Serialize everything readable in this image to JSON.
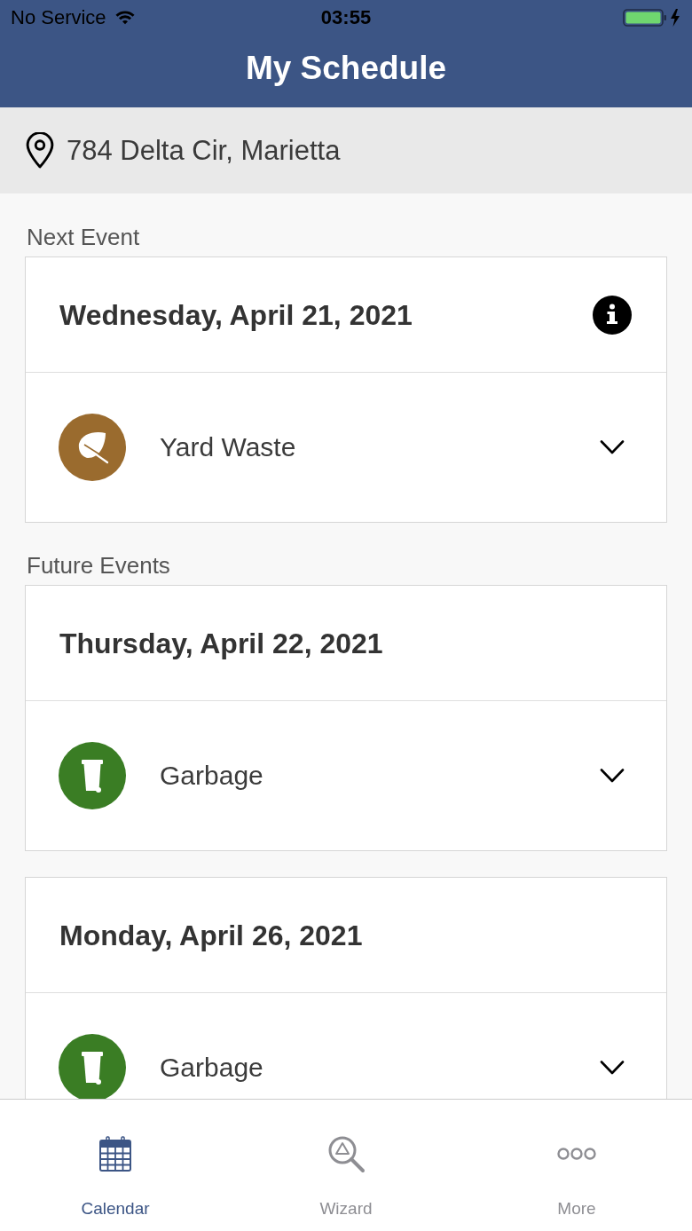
{
  "status_bar": {
    "carrier": "No Service",
    "time": "03:55"
  },
  "header": {
    "title": "My Schedule"
  },
  "location": {
    "address": "784 Delta Cir, Marietta"
  },
  "sections": [
    {
      "label": "Next Event",
      "events": [
        {
          "date": "Wednesday, April 21, 2021",
          "info": true,
          "items": [
            {
              "name": "Yard Waste",
              "kind": "yard_waste",
              "color": "#9a6b2e",
              "expanded": false
            }
          ]
        }
      ]
    },
    {
      "label": "Future Events",
      "events": [
        {
          "date": "Thursday, April 22, 2021",
          "info": false,
          "items": [
            {
              "name": "Garbage",
              "kind": "garbage",
              "color": "#3a7d24",
              "expanded": false
            }
          ]
        },
        {
          "date": "Monday, April 26, 2021",
          "info": false,
          "items": [
            {
              "name": "Garbage",
              "kind": "garbage",
              "color": "#3a7d24",
              "expanded": false
            }
          ]
        }
      ]
    }
  ],
  "tabs": [
    {
      "label": "Calendar",
      "kind": "calendar",
      "selected": true
    },
    {
      "label": "Wizard",
      "kind": "wizard",
      "selected": false
    },
    {
      "label": "More",
      "kind": "more",
      "selected": false
    }
  ]
}
